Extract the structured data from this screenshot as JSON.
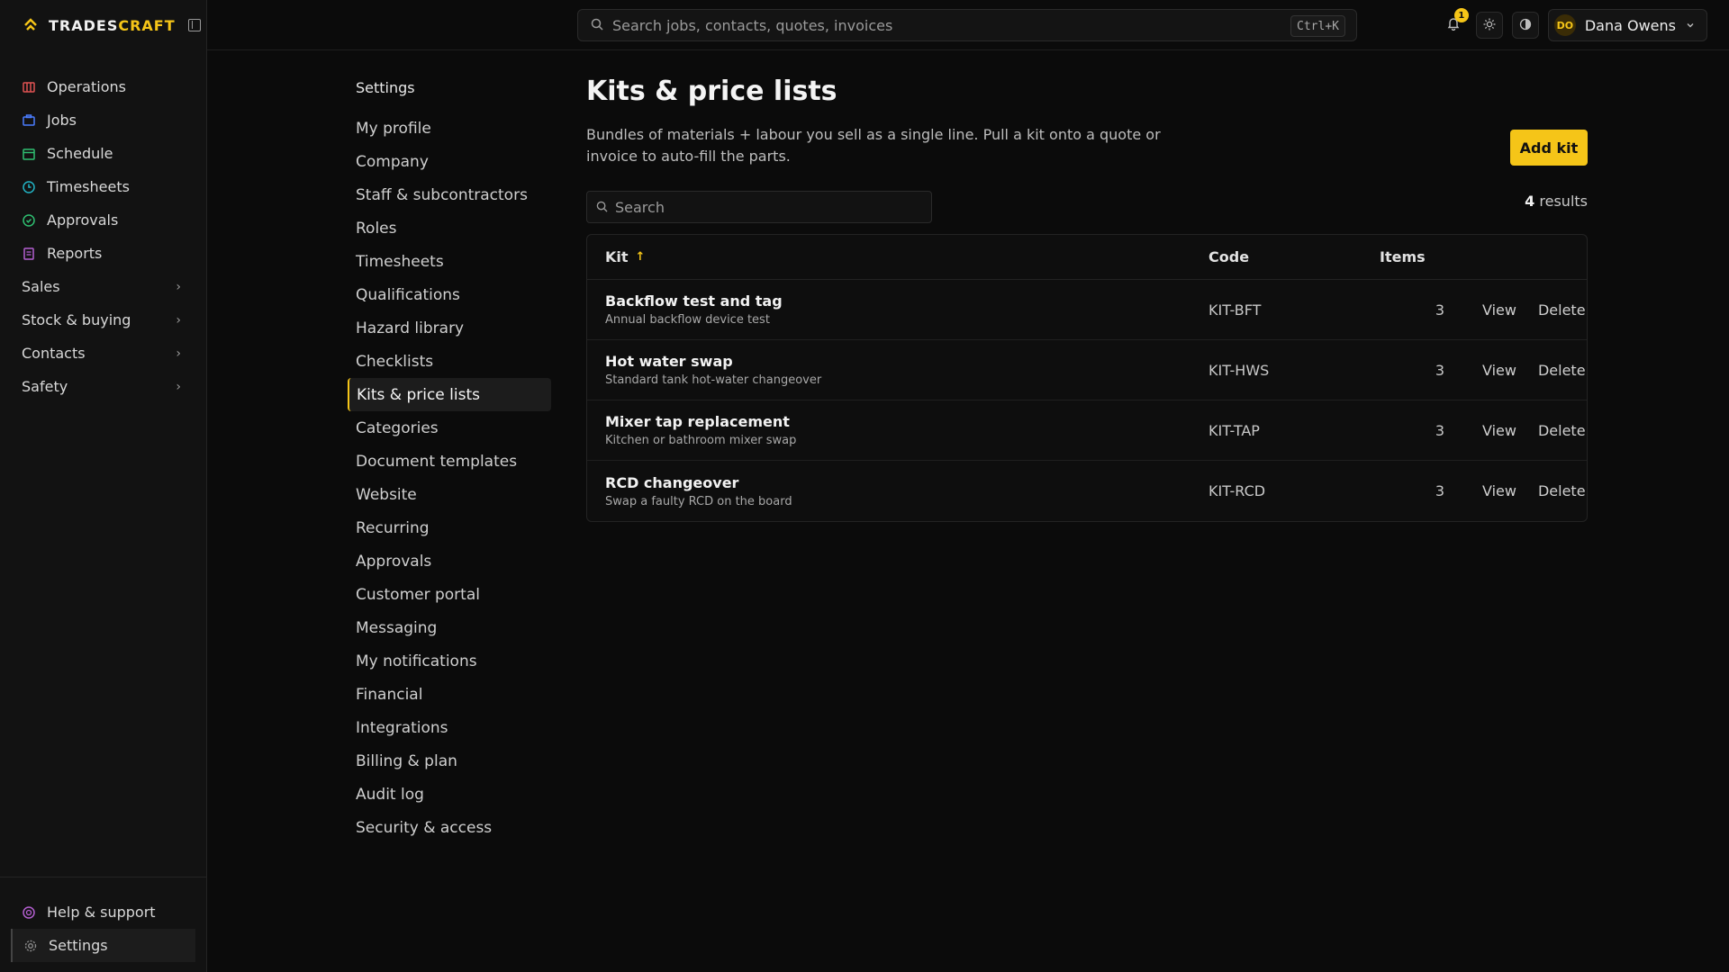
{
  "brand": {
    "name_part1": "TRADES",
    "name_part2": "CRAFT"
  },
  "colors": {
    "accent": "#f5c518",
    "bg": "#0b0b0b",
    "sidebar": "#121212"
  },
  "sidebar": {
    "items": [
      {
        "label": "Operations",
        "icon": "operations-icon",
        "color": "#e05252"
      },
      {
        "label": "Jobs",
        "icon": "jobs-icon",
        "color": "#4a7cff"
      },
      {
        "label": "Schedule",
        "icon": "calendar-icon",
        "color": "#2fbf71"
      },
      {
        "label": "Timesheets",
        "icon": "clock-icon",
        "color": "#22b3c4"
      },
      {
        "label": "Approvals",
        "icon": "check-circle-icon",
        "color": "#2fbf71"
      },
      {
        "label": "Reports",
        "icon": "report-icon",
        "color": "#b45fd1"
      }
    ],
    "groups": [
      {
        "label": "Sales"
      },
      {
        "label": "Stock & buying"
      },
      {
        "label": "Contacts"
      },
      {
        "label": "Safety"
      }
    ],
    "bottom": [
      {
        "label": "Help & support",
        "icon": "help-icon"
      },
      {
        "label": "Settings",
        "icon": "gear-icon"
      }
    ]
  },
  "topbar": {
    "search_placeholder": "Search jobs, contacts, quotes, invoices",
    "shortcut": "Ctrl+K",
    "notifications_count": "1",
    "user_initials": "DO",
    "user_name": "Dana Owens"
  },
  "settings_nav": {
    "title": "Settings",
    "items": [
      "My profile",
      "Company",
      "Staff & subcontractors",
      "Roles",
      "Timesheets",
      "Qualifications",
      "Hazard library",
      "Checklists",
      "Kits & price lists",
      "Categories",
      "Document templates",
      "Website",
      "Recurring",
      "Approvals",
      "Customer portal",
      "Messaging",
      "My notifications",
      "Financial",
      "Integrations",
      "Billing & plan",
      "Audit log",
      "Security & access"
    ],
    "active": "Kits & price lists"
  },
  "page": {
    "title": "Kits & price lists",
    "description": "Bundles of materials + labour you sell as a single line. Pull a kit onto a quote or invoice to auto-fill the parts.",
    "add_button": "Add kit",
    "search_placeholder": "Search",
    "results_count": "4",
    "results_label": "results"
  },
  "table": {
    "columns": {
      "kit": "Kit",
      "code": "Code",
      "items": "Items"
    },
    "sort_indicator": "↑",
    "rows": [
      {
        "name": "Backflow test and tag",
        "subtitle": "Annual backflow device test",
        "code": "KIT-BFT",
        "items": "3"
      },
      {
        "name": "Hot water swap",
        "subtitle": "Standard tank hot-water changeover",
        "code": "KIT-HWS",
        "items": "3"
      },
      {
        "name": "Mixer tap replacement",
        "subtitle": "Kitchen or bathroom mixer swap",
        "code": "KIT-TAP",
        "items": "3"
      },
      {
        "name": "RCD changeover",
        "subtitle": "Swap a faulty RCD on the board",
        "code": "KIT-RCD",
        "items": "3"
      }
    ],
    "actions": {
      "view": "View",
      "delete": "Delete"
    }
  }
}
